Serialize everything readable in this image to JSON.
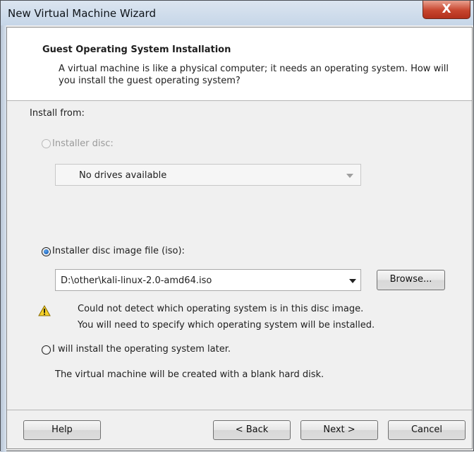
{
  "window": {
    "title": "New Virtual Machine Wizard",
    "close_glyph": "X"
  },
  "header": {
    "title": "Guest Operating System Installation",
    "description": "A virtual machine is like a physical computer; it needs an operating system. How will you install the guest operating system?"
  },
  "install_from_label": "Install from:",
  "options": {
    "installer_disc": {
      "label": "Installer disc:",
      "selected": false,
      "enabled": false,
      "dropdown_value": "No drives available"
    },
    "iso_file": {
      "label": "Installer disc image file (iso):",
      "selected": true,
      "path_value": "D:\\other\\kali-linux-2.0-amd64.iso",
      "browse_label": "Browse..."
    },
    "warning": {
      "line1": "Could not detect which operating system is in this disc image.",
      "line2": "You will need to specify which operating system will be installed.",
      "icon": "warning-icon"
    },
    "install_later": {
      "label": "I will install the operating system later.",
      "selected": false,
      "note": "The virtual machine will be created with a blank hard disk."
    }
  },
  "buttons": {
    "help": "Help",
    "back": "< Back",
    "next": "Next >",
    "cancel": "Cancel"
  },
  "colors": {
    "radio_selected": "#1a64c6",
    "warning_yellow": "#f4d12a",
    "close_red": "#c7452e"
  }
}
